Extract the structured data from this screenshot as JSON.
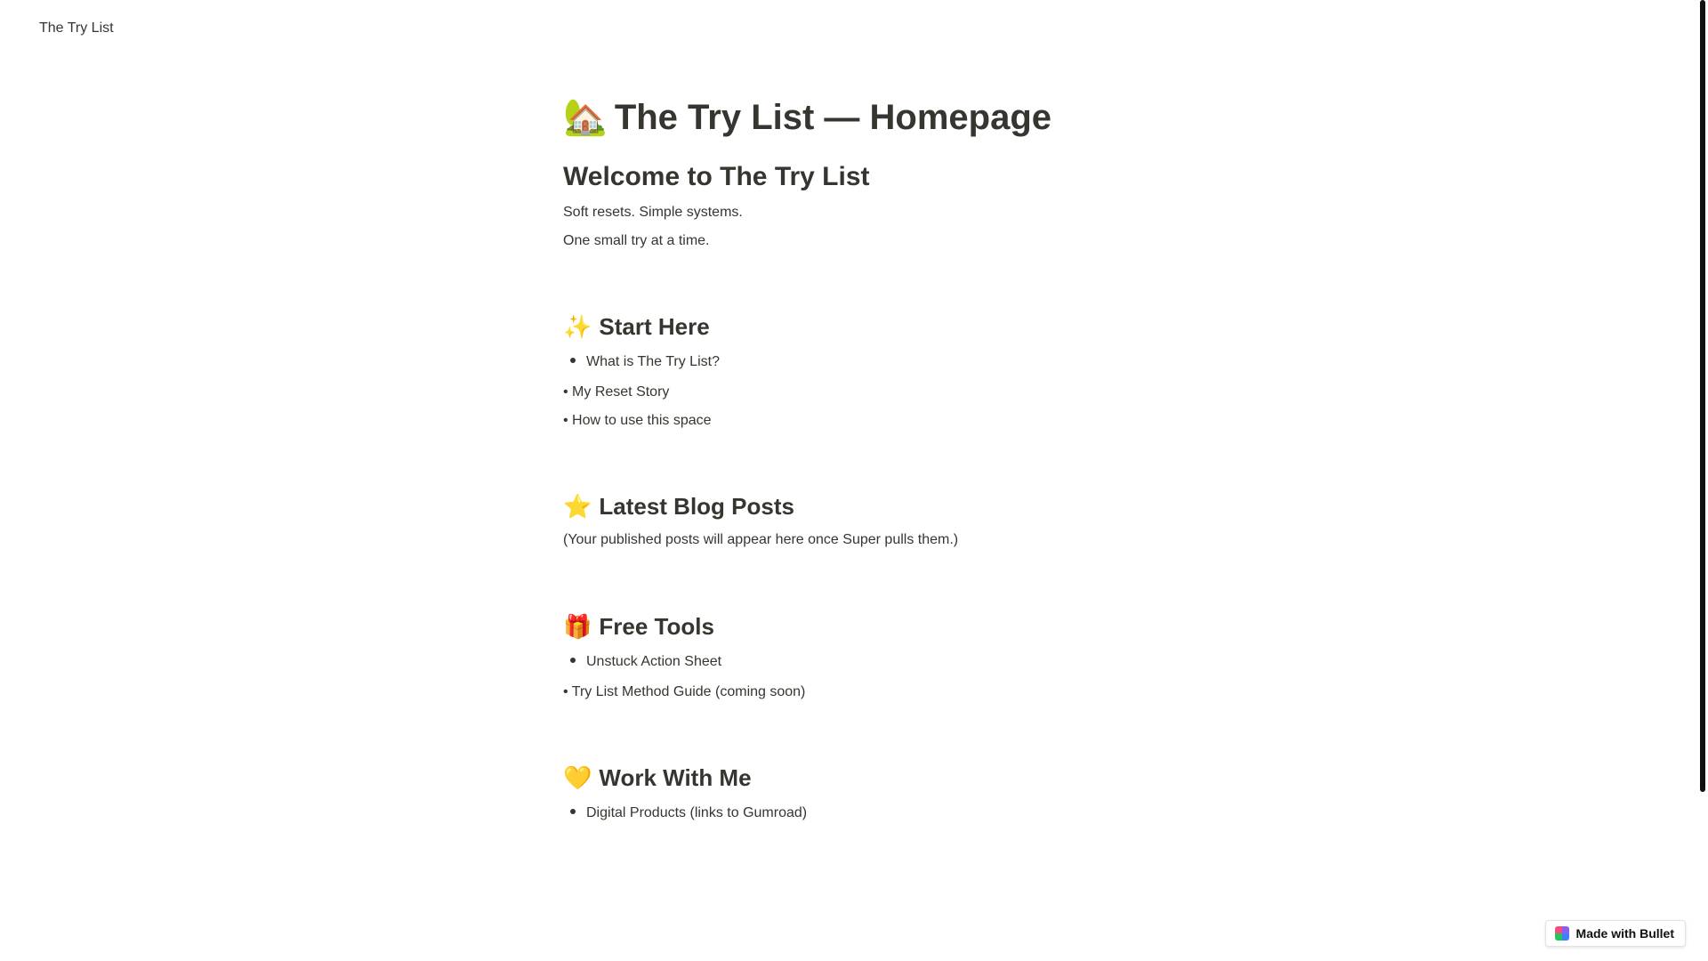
{
  "topbar": {
    "site_name": "The Try List"
  },
  "page": {
    "title_emoji": "🏡",
    "title": "The Try List — Homepage",
    "welcome_heading": "Welcome to The Try List",
    "tagline_1": "Soft resets. Simple systems.",
    "tagline_2": "One small try at a time."
  },
  "start_here": {
    "emoji": "✨",
    "heading": "Start Here",
    "item_1": "What is The Try List?",
    "item_2": "• My Reset Story",
    "item_3": "• How to use this space"
  },
  "blog": {
    "emoji": "⭐",
    "heading": "Latest Blog Posts",
    "placeholder": "(Your published posts will appear here once Super pulls them.)"
  },
  "tools": {
    "emoji": "🎁",
    "heading": "Free Tools",
    "item_1": "Unstuck Action Sheet",
    "item_2": "• Try List Method Guide (coming soon)"
  },
  "work": {
    "emoji": "💛",
    "heading": "Work With Me",
    "item_1": "Digital Products (links to Gumroad)"
  },
  "badge": {
    "label": "Made with Bullet"
  },
  "colors": {
    "text": "#37352f",
    "background": "#ffffff",
    "scrollbar": "#111111"
  }
}
